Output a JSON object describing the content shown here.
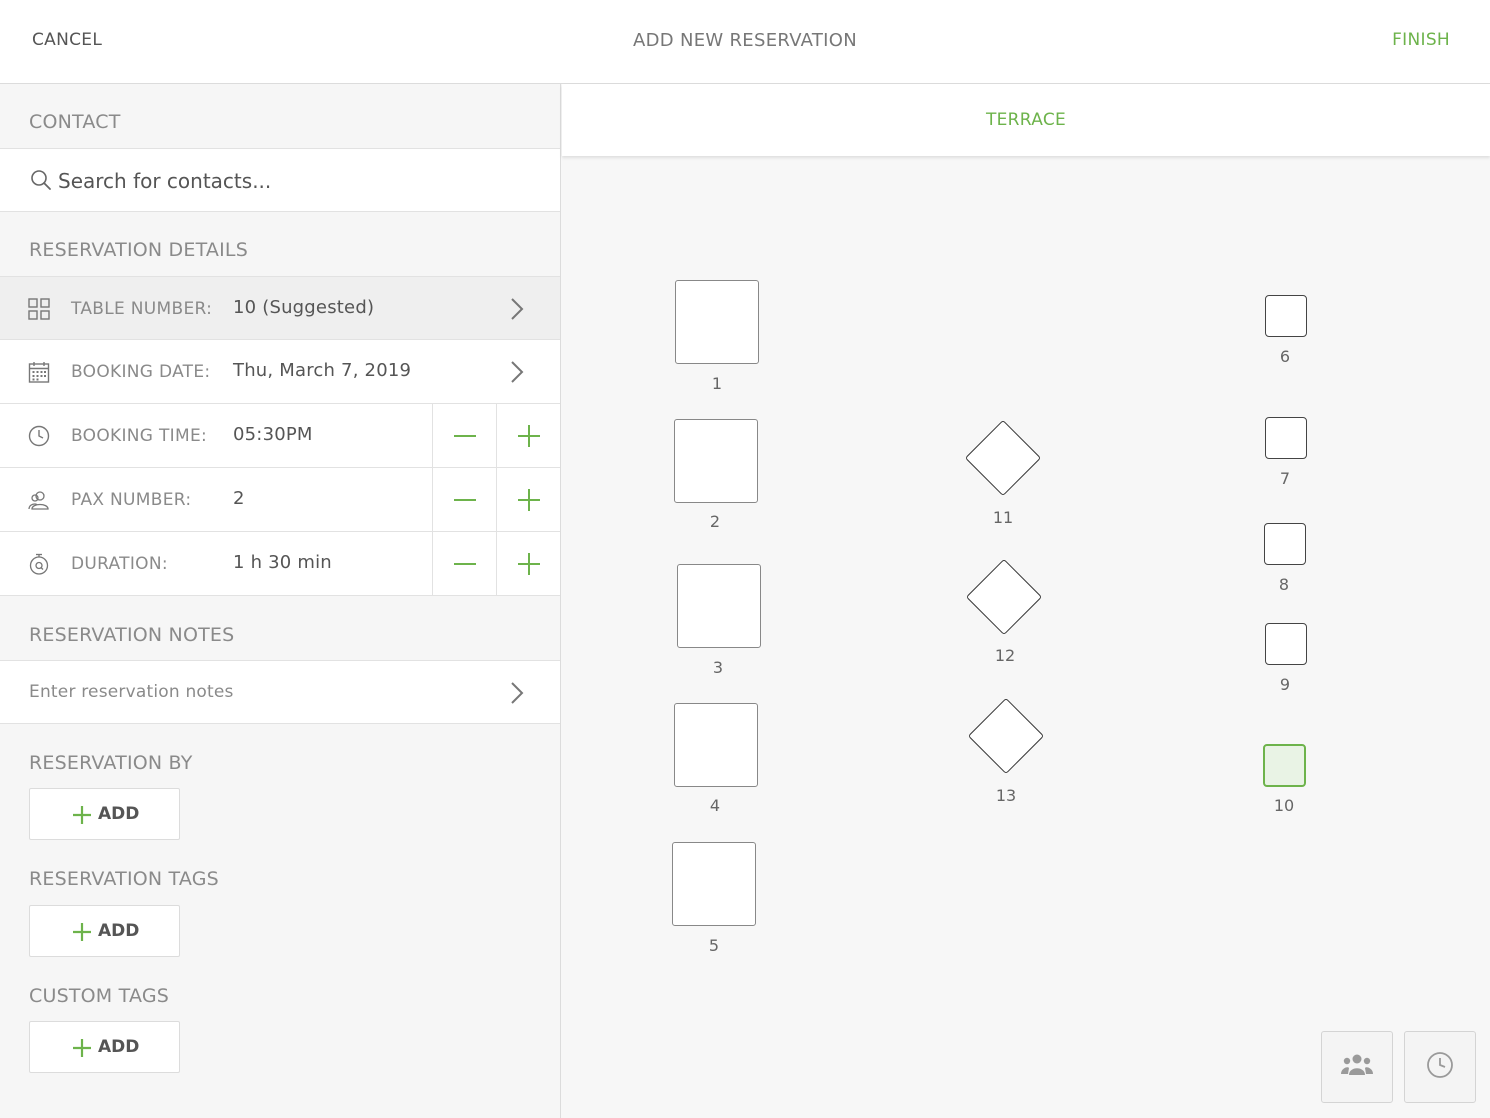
{
  "header": {
    "cancel_label": "CANCEL",
    "title": "ADD NEW RESERVATION",
    "finish_label": "FINISH"
  },
  "contact": {
    "section_title": "CONTACT",
    "search_placeholder": "Search for contacts..."
  },
  "details": {
    "section_title": "RESERVATION DETAILS",
    "table_number": {
      "label": "TABLE NUMBER:",
      "value": "10 (Suggested)"
    },
    "booking_date": {
      "label": "BOOKING DATE:",
      "value": "Thu, March 7, 2019"
    },
    "booking_time": {
      "label": "BOOKING TIME:",
      "value": "05:30PM"
    },
    "pax_number": {
      "label": "PAX NUMBER:",
      "value": "2"
    },
    "duration": {
      "label": "DURATION:",
      "value": "1 h 30 min"
    }
  },
  "notes": {
    "section_title": "RESERVATION NOTES",
    "placeholder": "Enter reservation notes"
  },
  "reservation_by": {
    "section_title": "RESERVATION BY",
    "add_label": "ADD"
  },
  "reservation_tags": {
    "section_title": "RESERVATION TAGS",
    "add_label": "ADD"
  },
  "custom_tags": {
    "section_title": "CUSTOM TAGS",
    "add_label": "ADD"
  },
  "floor": {
    "tab_label": "TERRACE",
    "selected_table": "10",
    "tables": [
      "1",
      "2",
      "3",
      "4",
      "5",
      "6",
      "7",
      "8",
      "9",
      "10",
      "11",
      "12",
      "13"
    ]
  },
  "colors": {
    "accent": "#6db34b",
    "selected_fill": "#e9f3e5"
  },
  "icons": {
    "search": "search-icon",
    "table": "grid-icon",
    "date": "calendar-icon",
    "time": "clock-icon",
    "pax": "people-icon",
    "duration": "stopwatch-icon",
    "chevron": "chevron-right-icon",
    "party_view": "group-icon",
    "time_view": "clock-icon"
  }
}
